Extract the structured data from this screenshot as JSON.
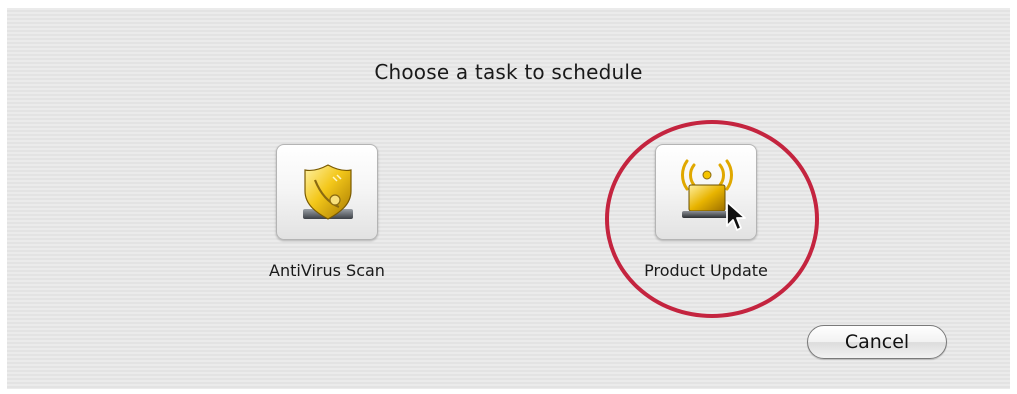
{
  "dialog": {
    "title": "Choose a task to schedule",
    "tasks": [
      {
        "label": "AntiVirus Scan",
        "icon": "shield-icon"
      },
      {
        "label": "Product Update",
        "icon": "wireless-update-icon"
      }
    ],
    "cancel_label": "Cancel"
  },
  "annotation": {
    "highlight_color": "#c4243f",
    "highlighted_task": "Product Update"
  },
  "colors": {
    "background": "#e8e8e8",
    "icon_gold": "#e8b400"
  }
}
